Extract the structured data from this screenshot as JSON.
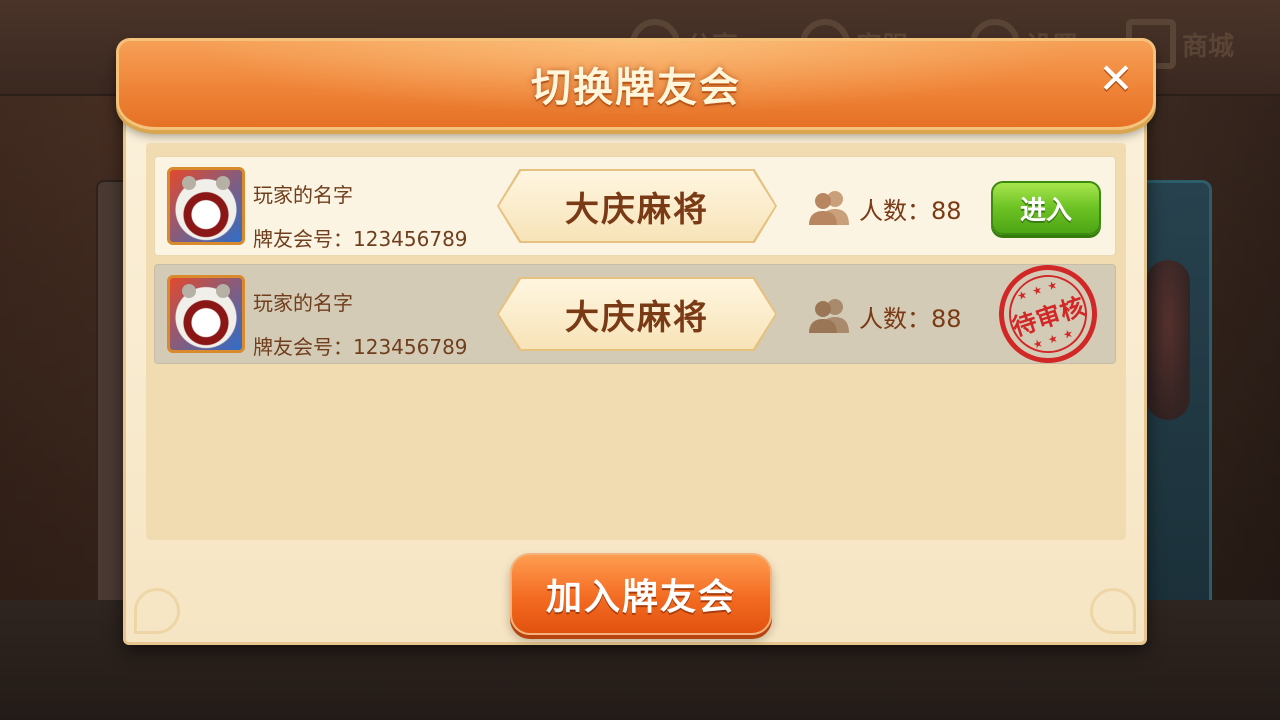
{
  "background": {
    "top_buttons": [
      {
        "label": "分享",
        "icon": "share-icon"
      },
      {
        "label": "客服",
        "icon": "service-icon"
      },
      {
        "label": "设置",
        "icon": "gear-icon"
      },
      {
        "label": "商城",
        "icon": "cart-icon"
      }
    ]
  },
  "dialog": {
    "title": "切换牌友会",
    "close_label": "✕",
    "join_button_label": "加入牌友会"
  },
  "clubs": [
    {
      "player_name": "玩家的名字",
      "club_id_text": "牌友会号：123456789",
      "club_name": "大庆麻将",
      "member_count_text": "人数：88",
      "status": "active",
      "action_label": "进入"
    },
    {
      "player_name": "玩家的名字",
      "club_id_text": "牌友会号：123456789",
      "club_name": "大庆麻将",
      "member_count_text": "人数：88",
      "status": "pending",
      "stamp_label": "待审核"
    }
  ],
  "colors": {
    "header_orange": "#ef8438",
    "enter_green": "#6cc223",
    "stamp_red": "#d22727",
    "text_brown": "#7a3a16"
  }
}
